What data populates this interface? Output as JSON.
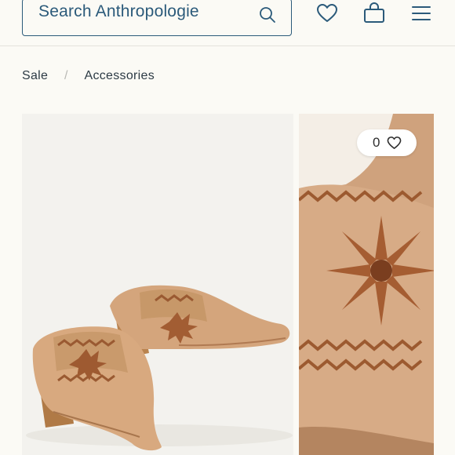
{
  "header": {
    "search_placeholder": "Search Anthropologie",
    "icons": [
      "search-icon",
      "heart-icon",
      "shopping-bag-icon",
      "hamburger-menu-icon"
    ],
    "accent_color": "#2b5a7a"
  },
  "breadcrumb": {
    "items": [
      "Sale",
      "Accessories"
    ],
    "separator": "/"
  },
  "gallery": {
    "like_count": "0",
    "like_icon": "heart-icon"
  }
}
